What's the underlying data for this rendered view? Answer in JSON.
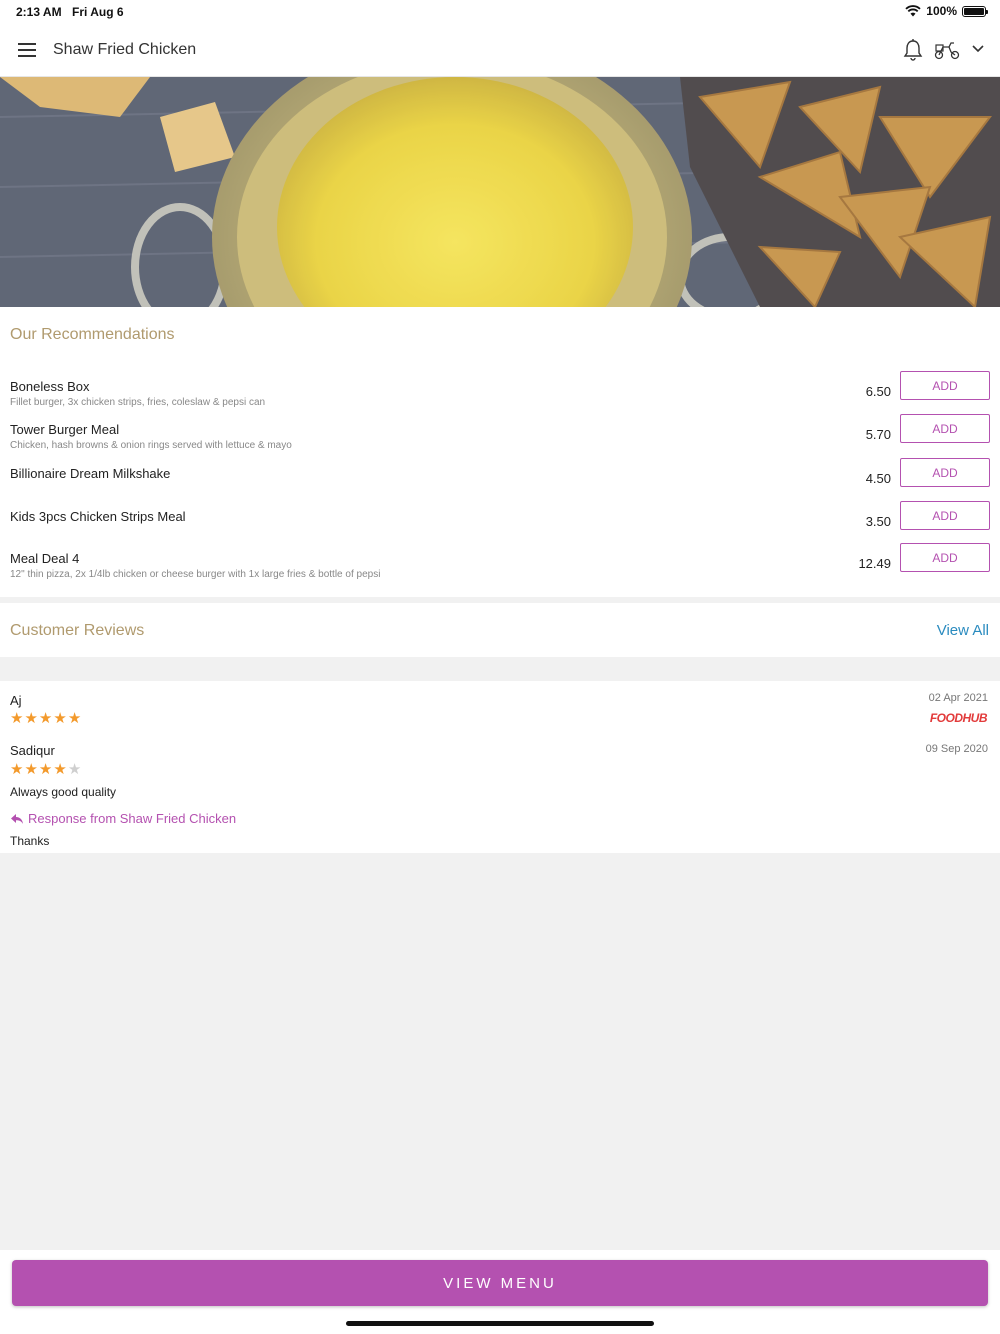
{
  "status_bar": {
    "time": "2:13 AM",
    "date": "Fri Aug 6",
    "battery": "100%"
  },
  "header": {
    "title": "Shaw Fried Chicken"
  },
  "recommendations": {
    "title": "Our Recommendations",
    "add_label": "ADD",
    "items": [
      {
        "name": "Boneless Box",
        "description": "Fillet burger, 3x chicken strips, fries, coleslaw & pepsi can",
        "price": "6.50"
      },
      {
        "name": "Tower Burger Meal",
        "description": "Chicken, hash browns & onion rings served with lettuce & mayo",
        "price": "5.70"
      },
      {
        "name": "Billionaire Dream Milkshake",
        "description": "",
        "price": "4.50"
      },
      {
        "name": "Kids 3pcs Chicken Strips Meal",
        "description": "",
        "price": "3.50"
      },
      {
        "name": "Meal Deal 4",
        "description": "12\" thin pizza, 2x 1/4lb chicken or cheese burger with 1x large fries & bottle of pepsi",
        "price": "12.49"
      }
    ]
  },
  "reviews": {
    "title": "Customer Reviews",
    "view_all": "View All",
    "items": [
      {
        "name": "Aj",
        "rating": 5,
        "date": "02 Apr 2021",
        "source": "FOODHUB"
      },
      {
        "name": "Sadiqur",
        "rating": 4,
        "date": "09 Sep 2020",
        "text": "Always good quality",
        "response_label": "Response from Shaw Fried Chicken",
        "response_text": "Thanks"
      }
    ]
  },
  "footer": {
    "view_menu": "VIEW MENU"
  },
  "colors": {
    "accent": "#b451b0",
    "section_title": "#b09a6e",
    "link": "#2a8bbf",
    "star": "#f39a2c"
  }
}
